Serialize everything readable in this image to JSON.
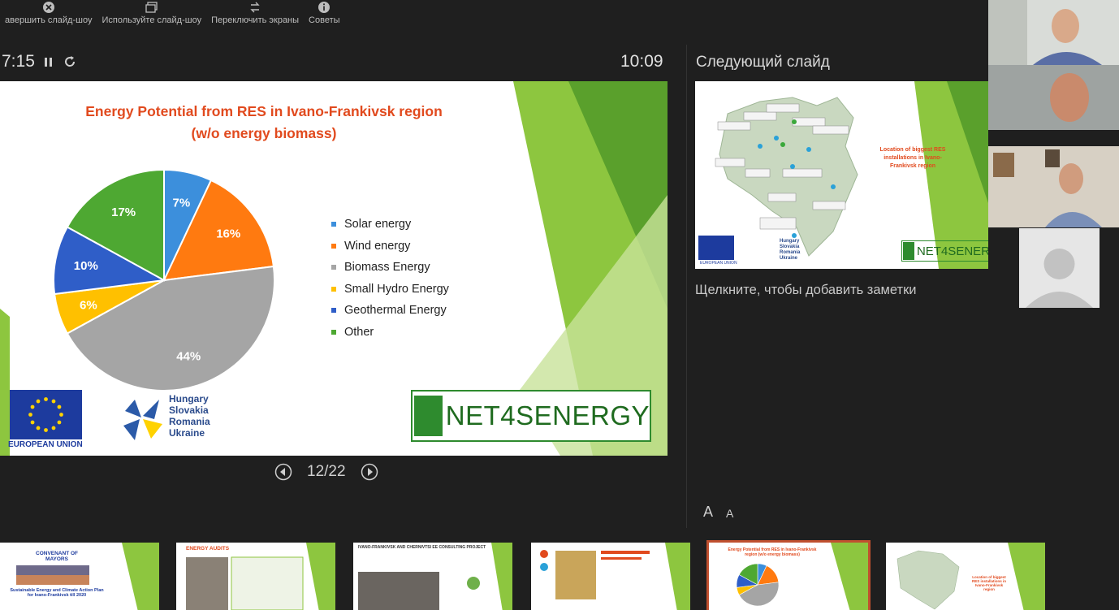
{
  "toolbar": {
    "items": [
      {
        "label": "авершить слайд-шоу",
        "icon": "close-icon"
      },
      {
        "label": "Используйте слайд-шоу",
        "icon": "window-icon"
      },
      {
        "label": "Переключить экраны",
        "icon": "swap-icon"
      },
      {
        "label": "Советы",
        "icon": "info-icon"
      }
    ]
  },
  "timer": {
    "elapsed": "7:15"
  },
  "clock": "10:09",
  "next_slide_title": "Следующий слайд",
  "notes_placeholder": "Щелкните, чтобы добавить заметки",
  "navigation": {
    "counter": "12/22"
  },
  "font_controls": {
    "increase": "A",
    "decrease": "A"
  },
  "slide": {
    "title_line1": "Energy Potential from RES in Ivano-Frankivsk region",
    "title_line2": "(w/o energy biomass)",
    "eu_label": "EUROPEAN UNION",
    "hu_lines": [
      "Hungary",
      "Slovakia",
      "Romania",
      "Ukraine"
    ],
    "net_logo": "NET4SENERGY"
  },
  "chart_data": {
    "type": "pie",
    "title": "Energy Potential from RES in Ivano-Frankivsk region (w/o energy biomass)",
    "categories": [
      "Solar energy",
      "Wind energy",
      "Biomass Energy",
      "Small Hydro Energy",
      "Geothermal Energy",
      "Other"
    ],
    "values": [
      7,
      16,
      44,
      6,
      10,
      17
    ],
    "labels": [
      "7%",
      "16%",
      "44%",
      "6%",
      "10%",
      "17%"
    ],
    "colors": [
      "#3c8fdc",
      "#ff7a10",
      "#a5a5a5",
      "#ffc000",
      "#2f5ec8",
      "#4ea832"
    ],
    "legend_position": "right"
  },
  "preview": {
    "title": "Location of biggest RES installations in Ivano-Frankivsk region",
    "eu_label": "EUROPEAN UNION",
    "hu_lines": [
      "Hungary",
      "Slovakia",
      "Romania",
      "Ukraine"
    ],
    "net_logo": "NET4SENER"
  },
  "thumbnails": [
    {
      "title": "CONVENANT OF MAYORS",
      "subtitle": "Sustainable Energy and Climate Action Plan for Ivano-Frankivsk till 2020"
    },
    {
      "title": "ENERGY AUDITS",
      "subtitle": ""
    },
    {
      "title": "IVANO-FRANKIVSK AND CHERNIVTSI EE CONSULTING PROJECT",
      "subtitle": ""
    },
    {
      "title": "",
      "subtitle": ""
    },
    {
      "title": "Energy Potential from RES in Ivano-Frankivsk region (w/o energy biomass)",
      "subtitle": ""
    },
    {
      "title": "Location of biggest RES installations in Ivano-Frankivsk region",
      "subtitle": ""
    }
  ]
}
